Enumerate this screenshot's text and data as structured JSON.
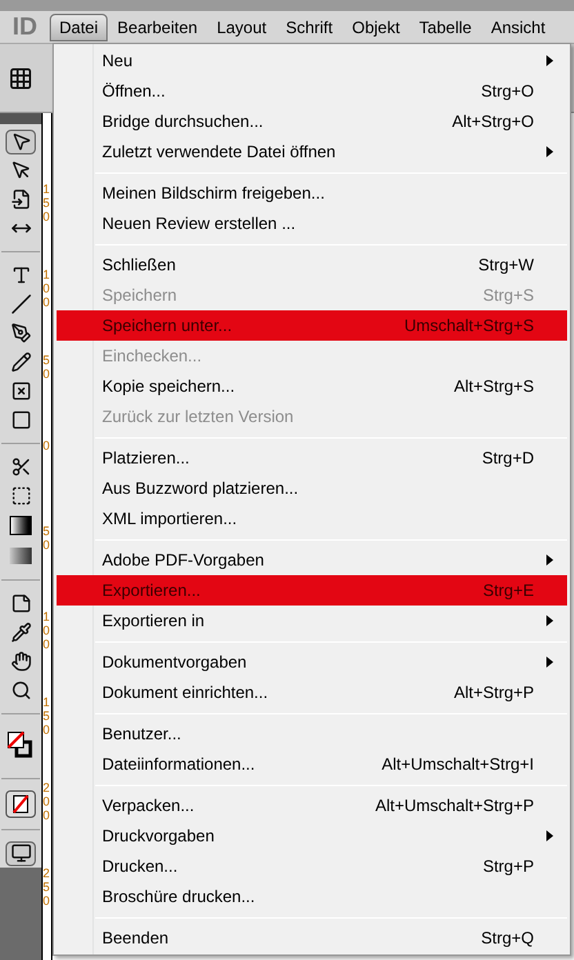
{
  "app_logo": "ID",
  "menu_bar": [
    {
      "label": "Datei",
      "selected": true
    },
    {
      "label": "Bearbeiten",
      "selected": false
    },
    {
      "label": "Layout",
      "selected": false
    },
    {
      "label": "Schrift",
      "selected": false
    },
    {
      "label": "Objekt",
      "selected": false
    },
    {
      "label": "Tabelle",
      "selected": false
    },
    {
      "label": "Ansicht",
      "selected": false
    }
  ],
  "ruler_labels": [
    "150",
    "100",
    "50",
    "0",
    "50",
    "100",
    "150",
    "200",
    "250"
  ],
  "menu_groups": [
    [
      {
        "label": "Neu",
        "submenu": true,
        "disabled": false,
        "selected": false
      },
      {
        "label": "Öffnen...",
        "shortcut": "Strg+O",
        "submenu": false,
        "disabled": false,
        "selected": false
      },
      {
        "label": "Bridge durchsuchen...",
        "shortcut": "Alt+Strg+O",
        "submenu": false,
        "disabled": false,
        "selected": false
      },
      {
        "label": "Zuletzt verwendete Datei öffnen",
        "submenu": true,
        "disabled": false,
        "selected": false
      }
    ],
    [
      {
        "label": "Meinen Bildschirm freigeben...",
        "submenu": false,
        "disabled": false,
        "selected": false
      },
      {
        "label": "Neuen Review erstellen ...",
        "submenu": false,
        "disabled": false,
        "selected": false
      }
    ],
    [
      {
        "label": "Schließen",
        "shortcut": "Strg+W",
        "submenu": false,
        "disabled": false,
        "selected": false
      },
      {
        "label": "Speichern",
        "shortcut": "Strg+S",
        "submenu": false,
        "disabled": true,
        "selected": false
      },
      {
        "label": "Speichern unter...",
        "shortcut": "Umschalt+Strg+S",
        "submenu": false,
        "disabled": false,
        "selected": true
      },
      {
        "label": "Einchecken...",
        "submenu": false,
        "disabled": true,
        "selected": false
      },
      {
        "label": "Kopie speichern...",
        "shortcut": "Alt+Strg+S",
        "submenu": false,
        "disabled": false,
        "selected": false
      },
      {
        "label": "Zurück zur letzten Version",
        "submenu": false,
        "disabled": true,
        "selected": false
      }
    ],
    [
      {
        "label": "Platzieren...",
        "shortcut": "Strg+D",
        "submenu": false,
        "disabled": false,
        "selected": false
      },
      {
        "label": "Aus Buzzword platzieren...",
        "submenu": false,
        "disabled": false,
        "selected": false
      },
      {
        "label": "XML importieren...",
        "submenu": false,
        "disabled": false,
        "selected": false
      }
    ],
    [
      {
        "label": "Adobe PDF-Vorgaben",
        "submenu": true,
        "disabled": false,
        "selected": false
      },
      {
        "label": "Exportieren...",
        "shortcut": "Strg+E",
        "submenu": false,
        "disabled": false,
        "selected": true
      },
      {
        "label": "Exportieren in",
        "submenu": true,
        "disabled": false,
        "selected": false
      }
    ],
    [
      {
        "label": "Dokumentvorgaben",
        "submenu": true,
        "disabled": false,
        "selected": false
      },
      {
        "label": "Dokument einrichten...",
        "shortcut": "Alt+Strg+P",
        "submenu": false,
        "disabled": false,
        "selected": false
      }
    ],
    [
      {
        "label": "Benutzer...",
        "submenu": false,
        "disabled": false,
        "selected": false
      },
      {
        "label": "Dateiinformationen...",
        "shortcut": "Alt+Umschalt+Strg+I",
        "submenu": false,
        "disabled": false,
        "selected": false
      }
    ],
    [
      {
        "label": "Verpacken...",
        "shortcut": "Alt+Umschalt+Strg+P",
        "submenu": false,
        "disabled": false,
        "selected": false
      },
      {
        "label": "Druckvorgaben",
        "submenu": true,
        "disabled": false,
        "selected": false
      },
      {
        "label": "Drucken...",
        "shortcut": "Strg+P",
        "submenu": false,
        "disabled": false,
        "selected": false
      },
      {
        "label": "Broschüre drucken...",
        "submenu": false,
        "disabled": false,
        "selected": false
      }
    ],
    [
      {
        "label": "Beenden",
        "shortcut": "Strg+Q",
        "submenu": false,
        "disabled": false,
        "selected": false
      }
    ]
  ]
}
